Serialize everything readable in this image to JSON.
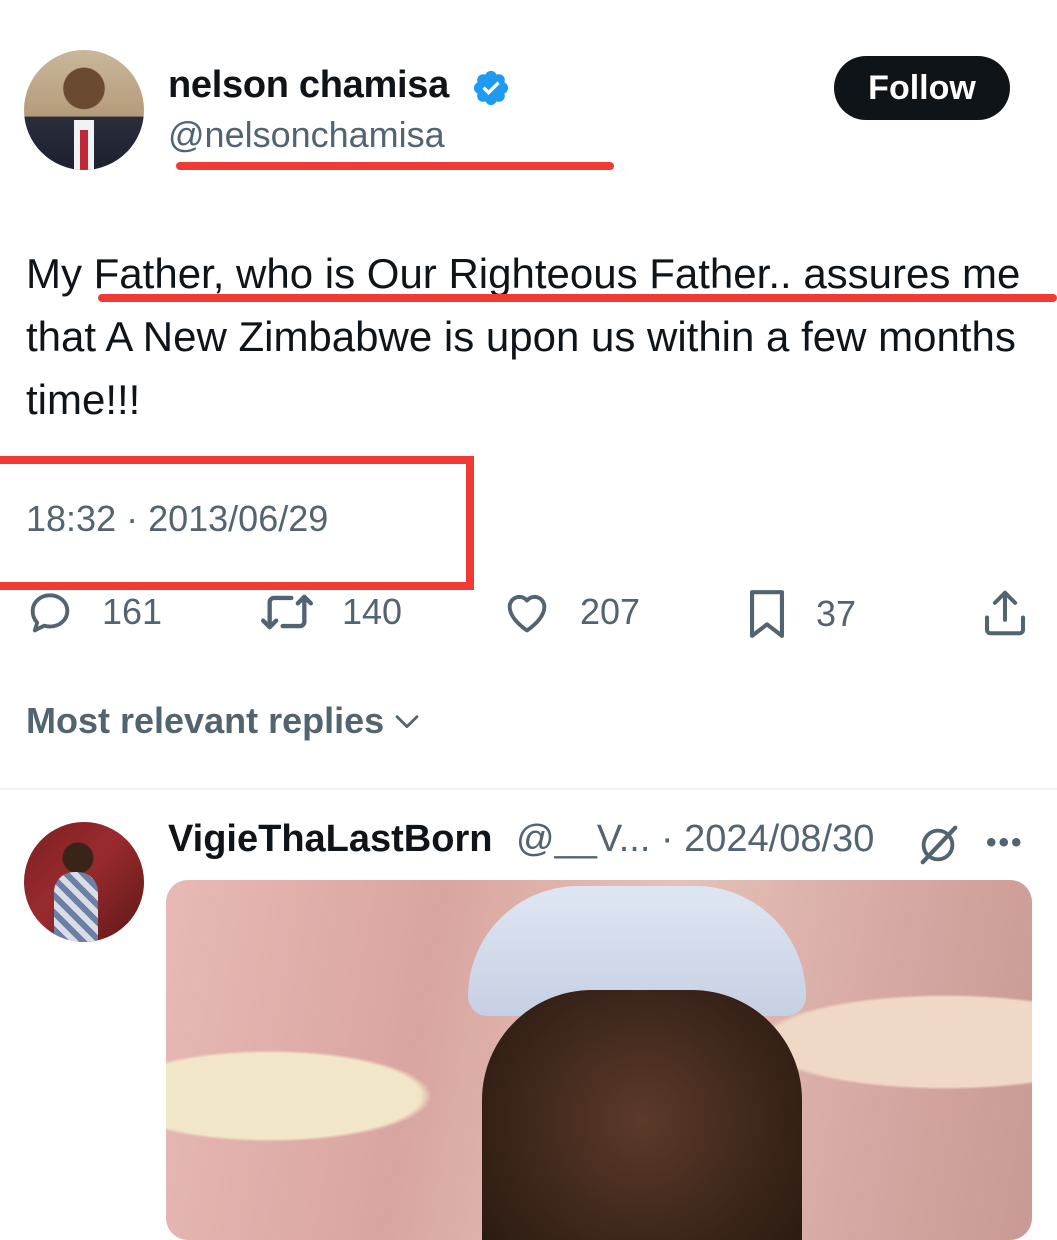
{
  "tweet": {
    "author_name": "nelson chamisa",
    "author_handle": "@nelsonchamisa",
    "follow_label": "Follow",
    "verified_icon": "verified-badge-icon",
    "text": "My Father, who is Our Righteous Father.. assures me that A New Zimbabwe is upon us within a few months time!!!",
    "timestamp": "18:32 · 2013/06/29",
    "stats": {
      "replies": "161",
      "reposts": "140",
      "likes": "207",
      "bookmarks": "37"
    }
  },
  "replies_section": {
    "sort_label": "Most relevant replies"
  },
  "reply": {
    "author_name": "VigieThaLastBorn",
    "meta": "@__V... · 2024/08/30"
  },
  "colors": {
    "annotation_red": "#f23a35",
    "verified_blue": "#1d9bf0",
    "secondary_text": "#536471"
  }
}
